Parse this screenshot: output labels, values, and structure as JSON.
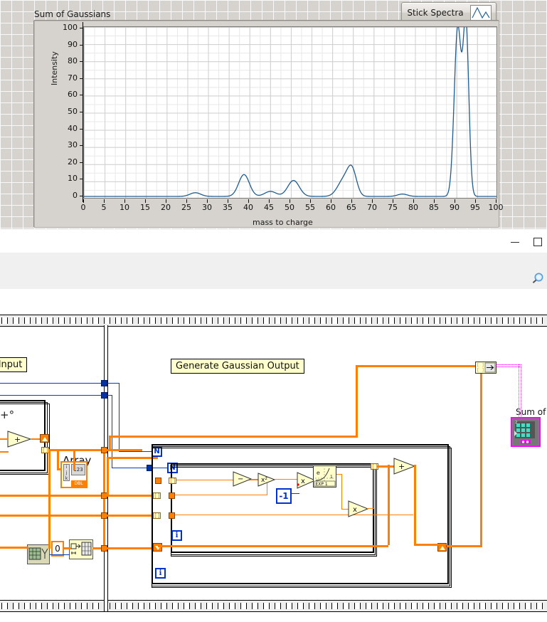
{
  "front_panel": {
    "graph_title": "Sum of Gaussians",
    "stick_button": {
      "label": "Stick Spectra",
      "icon": "waveform-glyph-icon"
    }
  },
  "chart_data": {
    "type": "line",
    "title": "Sum of Gaussians",
    "xlabel": "mass to charge",
    "ylabel": "Intensity",
    "xlim": [
      0,
      100
    ],
    "ylim": [
      0,
      100
    ],
    "xticks": [
      0,
      5,
      10,
      15,
      20,
      25,
      30,
      35,
      40,
      45,
      50,
      55,
      60,
      65,
      70,
      75,
      80,
      85,
      90,
      95,
      100
    ],
    "yticks": [
      0,
      10,
      20,
      30,
      40,
      50,
      60,
      70,
      80,
      90,
      100
    ],
    "grid": true,
    "legend": false,
    "line_color": "#1f5c8f",
    "series": [
      {
        "name": "Sum of Gaussians",
        "peaks": [
          {
            "center": 27.0,
            "height": 2.2,
            "width": 1.3
          },
          {
            "center": 38.8,
            "height": 13.0,
            "width": 1.3
          },
          {
            "center": 45.2,
            "height": 3.0,
            "width": 1.4
          },
          {
            "center": 50.8,
            "height": 9.5,
            "width": 1.4
          },
          {
            "center": 63.0,
            "height": 9.8,
            "width": 1.5
          },
          {
            "center": 65.0,
            "height": 14.0,
            "width": 1.1
          },
          {
            "center": 77.2,
            "height": 1.4,
            "width": 1.2
          },
          {
            "center": 90.6,
            "height": 100.0,
            "width": 0.85
          },
          {
            "center": 92.6,
            "height": 100.0,
            "width": 0.7
          }
        ]
      }
    ]
  },
  "window_chrome": {
    "minimize_label": "minimize-icon",
    "maximize_label": "maximize-icon",
    "search_label": "search-icon"
  },
  "block_diagram": {
    "labels": [
      {
        "id": "gaussian-input",
        "text": "sian Input"
      },
      {
        "id": "generate-gaussian-output",
        "text": "Generate Gaussian Output"
      },
      {
        "id": "array-label",
        "text": "Array"
      },
      {
        "id": "sum-of-indicator-label",
        "text": "Sum of"
      }
    ],
    "constants": {
      "minus_one": "-1",
      "zero": "0"
    },
    "terminals": {
      "outer_count": "N",
      "inner_count": "N",
      "outer_index": "i",
      "inner_index": "i",
      "array_index_i": "i",
      "array_index_j": "j",
      "array_index_k": "k",
      "array_type": "DBL",
      "array_value": "123"
    },
    "functions": {
      "add": "+",
      "subtract": "-",
      "square": "x²",
      "multiply": "x",
      "exponential": "EXP",
      "exponential_e": "e"
    },
    "colors": {
      "orange_wire": "#ff8000",
      "blue_wire": "#0040c0",
      "pink_wire": "#ff00ff",
      "label_bg": "#ffffcc",
      "node_bg": "#ffffcc"
    }
  }
}
